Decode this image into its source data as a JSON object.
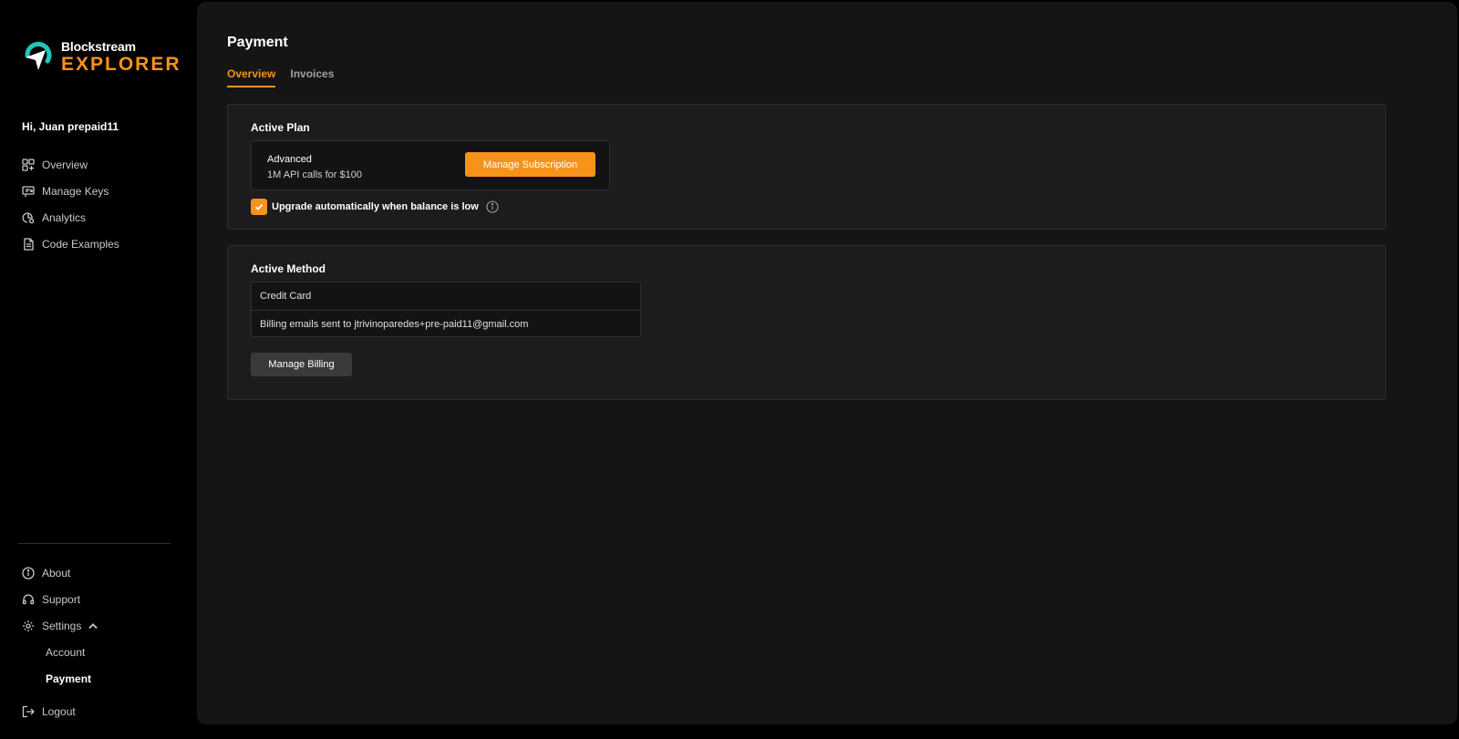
{
  "brand": {
    "name_line1": "Blockstream",
    "name_line2": "EXPLORER",
    "accent_color": "#f7931a",
    "logo_icon": "blockstream-logo-icon"
  },
  "sidebar": {
    "greeting": "Hi, Juan prepaid11",
    "items": [
      {
        "label": "Overview",
        "icon": "grid-plus-icon"
      },
      {
        "label": "Manage Keys",
        "icon": "key-icon"
      },
      {
        "label": "Analytics",
        "icon": "analytics-icon"
      },
      {
        "label": "Code Examples",
        "icon": "document-icon"
      }
    ],
    "bottom_items": [
      {
        "label": "About",
        "icon": "info-icon"
      },
      {
        "label": "Support",
        "icon": "headset-icon"
      },
      {
        "label": "Settings",
        "icon": "gear-icon"
      }
    ],
    "settings_sub": [
      {
        "label": "Account",
        "active": false
      },
      {
        "label": "Payment",
        "active": true
      }
    ],
    "logout_label": "Logout"
  },
  "main": {
    "title": "Payment",
    "tabs": [
      {
        "label": "Overview",
        "active": true
      },
      {
        "label": "Invoices",
        "active": false
      }
    ],
    "active_plan": {
      "heading": "Active Plan",
      "plan_name": "Advanced",
      "plan_desc": "1M API calls for $100",
      "manage_button": "Manage Subscription",
      "auto_upgrade_label": "Upgrade automatically when balance is low",
      "auto_upgrade_checked": true
    },
    "active_method": {
      "heading": "Active Method",
      "method": "Credit Card",
      "billing_email": "Billing emails sent to jtrivinoparedes+pre-paid11@gmail.com",
      "manage_button": "Manage Billing"
    }
  }
}
